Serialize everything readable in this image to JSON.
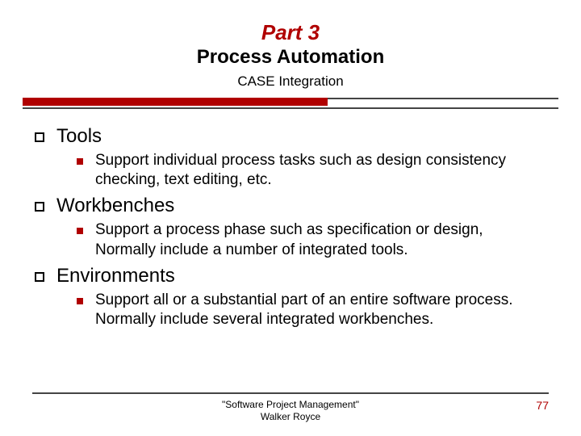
{
  "header": {
    "part": "Part 3",
    "subtitle": "Process Automation",
    "case": "CASE Integration"
  },
  "items": [
    {
      "title": "Tools",
      "body": "Support individual process tasks such as design consistency checking, text editing, etc."
    },
    {
      "title": "Workbenches",
      "body": "Support a process phase such as specification or design, Normally include a number of integrated tools."
    },
    {
      "title": "Environments",
      "body": "Support all or a substantial part of an entire software process. Normally include several integrated workbenches."
    }
  ],
  "footer": {
    "source_line1": "\"Software Project Management\"",
    "source_line2": "Walker Royce",
    "page": "77"
  }
}
